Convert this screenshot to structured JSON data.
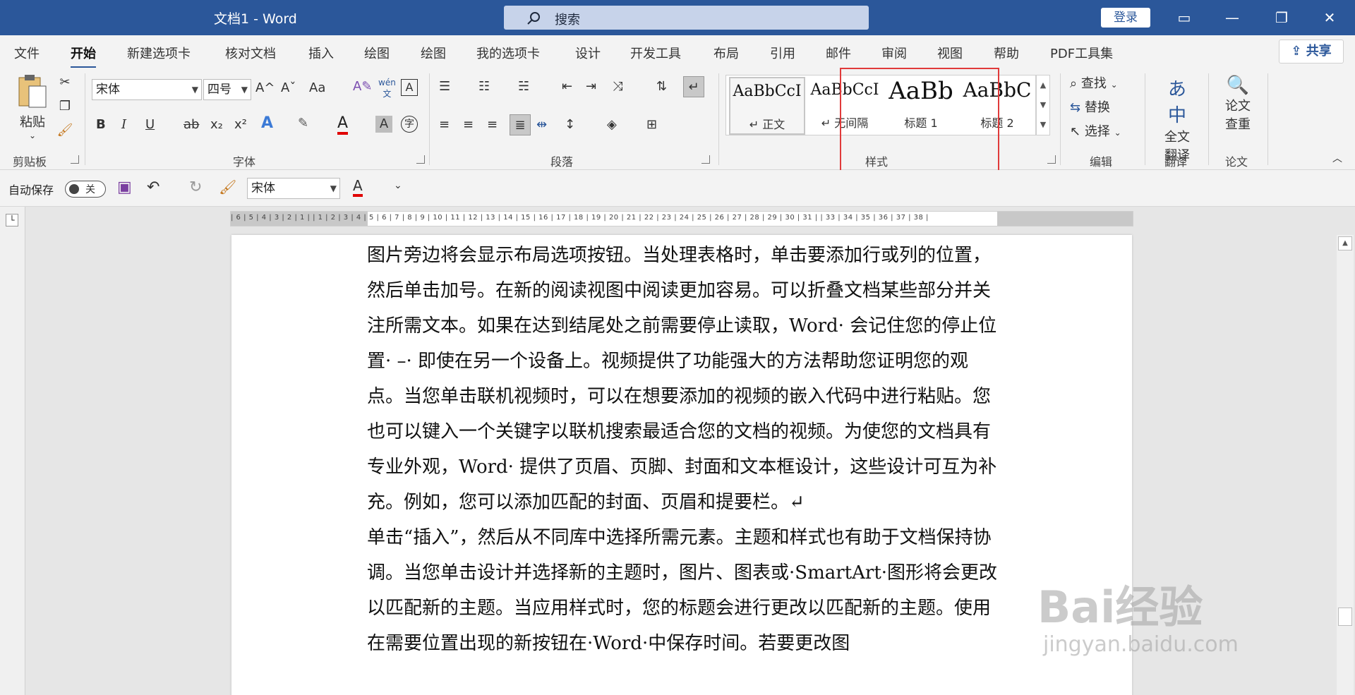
{
  "window": {
    "title": "文档1 - Word",
    "search_placeholder": "搜索",
    "login": "登录",
    "minimize": "—",
    "restore": "❐",
    "close": "✕",
    "ribbon_display": "▭"
  },
  "menu": {
    "tabs": [
      "文件",
      "开始",
      "新建选项卡",
      "核对文档",
      "插入",
      "绘图",
      "绘图",
      "我的选项卡",
      "设计",
      "开发工具",
      "布局",
      "引用",
      "邮件",
      "审阅",
      "视图",
      "帮助",
      "PDF工具集"
    ],
    "active": "开始",
    "share": "共享"
  },
  "ribbon": {
    "clipboard": {
      "label": "剪贴板",
      "paste": "粘贴"
    },
    "font": {
      "label": "字体",
      "font_name": "宋体",
      "font_size": "四号",
      "bold": "B",
      "italic": "I",
      "underline": "U",
      "strike": "ab",
      "sub": "x₂",
      "sup": "x²",
      "grow": "A^",
      "shrink": "Aˇ",
      "case": "Aa",
      "phonetic": "wén",
      "phonetic2": "文"
    },
    "paragraph": {
      "label": "段落"
    },
    "styles": {
      "label": "样式",
      "items": [
        {
          "preview": "AaBbCcI",
          "name": "↵ 正文"
        },
        {
          "preview": "AaBbCcI",
          "name": "↵ 无间隔"
        },
        {
          "preview": "AaBb",
          "name": "标题 1"
        },
        {
          "preview": "AaBbC",
          "name": "标题 2"
        }
      ]
    },
    "editing": {
      "label": "编辑",
      "find": "查找",
      "replace": "替换",
      "select": "选择"
    },
    "translate": {
      "label": "翻译",
      "full": "全文",
      "full2": "翻译"
    },
    "paper": {
      "label": "论文",
      "check": "论文",
      "check2": "查重"
    }
  },
  "qat": {
    "autosave": "自动保存",
    "toggle": "关",
    "font": "宋体"
  },
  "ruler": {
    "numbers": "| 6 | 5 | 4 | 3 | 2 | 1 |     | 1 | 2 | 3 | 4 | 5 | 6 | 7 | 8 | 9 | 10 | 11 | 12 | 13 | 14 | 15 | 16 | 17 | 18 | 19 | 20 | 21 | 22 | 23 | 24 | 25 | 26 | 27 | 28 | 29 | 30 | 31 |     | 33 | 34 | 35 | 36 | 37 | 38 |"
  },
  "document": {
    "paragraph1": "图片旁边将会显示布局选项按钮。当处理表格时，单击要添加行或列的位置，然后单击加号。在新的阅读视图中阅读更加容易。可以折叠文档某些部分并关注所需文本。如果在达到结尾处之前需要停止读取，Word· 会记住您的停止位置· –· 即使在另一个设备上。视频提供了功能强大的方法帮助您证明您的观点。当您单击联机视频时，可以在想要添加的视频的嵌入代码中进行粘贴。您也可以键入一个关键字以联机搜索最适合您的文档的视频。为使您的文档具有专业外观，Word· 提供了页眉、页脚、封面和文本框设计，这些设计可互为补充。例如，您可以添加匹配的封面、页眉和提要栏。↵",
    "paragraph2": "单击“插入”，然后从不同库中选择所需元素。主题和样式也有助于文档保持协调。当您单击设计并选择新的主题时，图片、图表或·SmartArt·图形将会更改以匹配新的主题。当应用样式时，您的标题会进行更改以匹配新的主题。使用在需要位置出现的新按钮在·Word·中保存时间。若要更改图"
  },
  "watermark": {
    "main": "Bai经验",
    "sub": "jingyan.baidu.com"
  }
}
